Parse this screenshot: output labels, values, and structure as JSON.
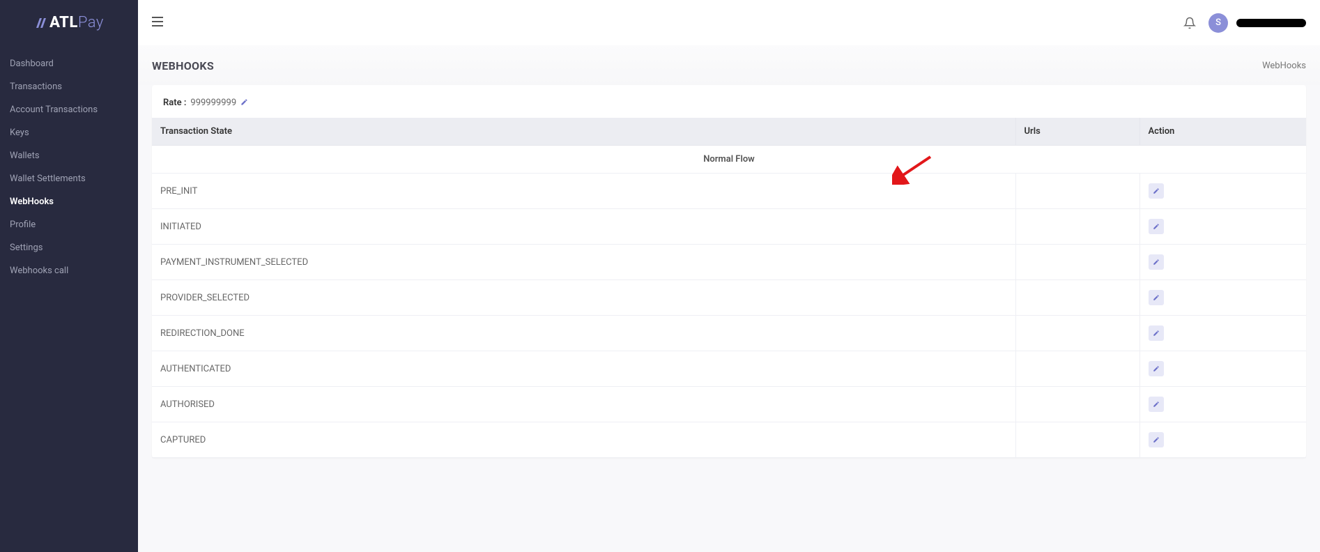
{
  "brand": {
    "bold": "ATL",
    "thin": "Pay"
  },
  "sidebar": {
    "items": [
      {
        "label": "Dashboard"
      },
      {
        "label": "Transactions"
      },
      {
        "label": "Account Transactions"
      },
      {
        "label": "Keys"
      },
      {
        "label": "Wallets"
      },
      {
        "label": "Wallet Settlements"
      },
      {
        "label": "WebHooks",
        "active": true
      },
      {
        "label": "Profile"
      },
      {
        "label": "Settings"
      },
      {
        "label": "Webhooks call"
      }
    ]
  },
  "header": {
    "avatar_initial": "S"
  },
  "page": {
    "title": "WEBHOOKS",
    "breadcrumb": "WebHooks"
  },
  "rate": {
    "label": "Rate :",
    "value": "999999999"
  },
  "table": {
    "columns": {
      "state": "Transaction State",
      "urls": "Urls",
      "action": "Action"
    },
    "section_label": "Normal Flow",
    "rows": [
      {
        "state": "PRE_INIT",
        "urls": ""
      },
      {
        "state": "INITIATED",
        "urls": ""
      },
      {
        "state": "PAYMENT_INSTRUMENT_SELECTED",
        "urls": ""
      },
      {
        "state": "PROVIDER_SELECTED",
        "urls": ""
      },
      {
        "state": "REDIRECTION_DONE",
        "urls": ""
      },
      {
        "state": "AUTHENTICATED",
        "urls": ""
      },
      {
        "state": "AUTHORISED",
        "urls": ""
      },
      {
        "state": "CAPTURED",
        "urls": ""
      }
    ]
  }
}
